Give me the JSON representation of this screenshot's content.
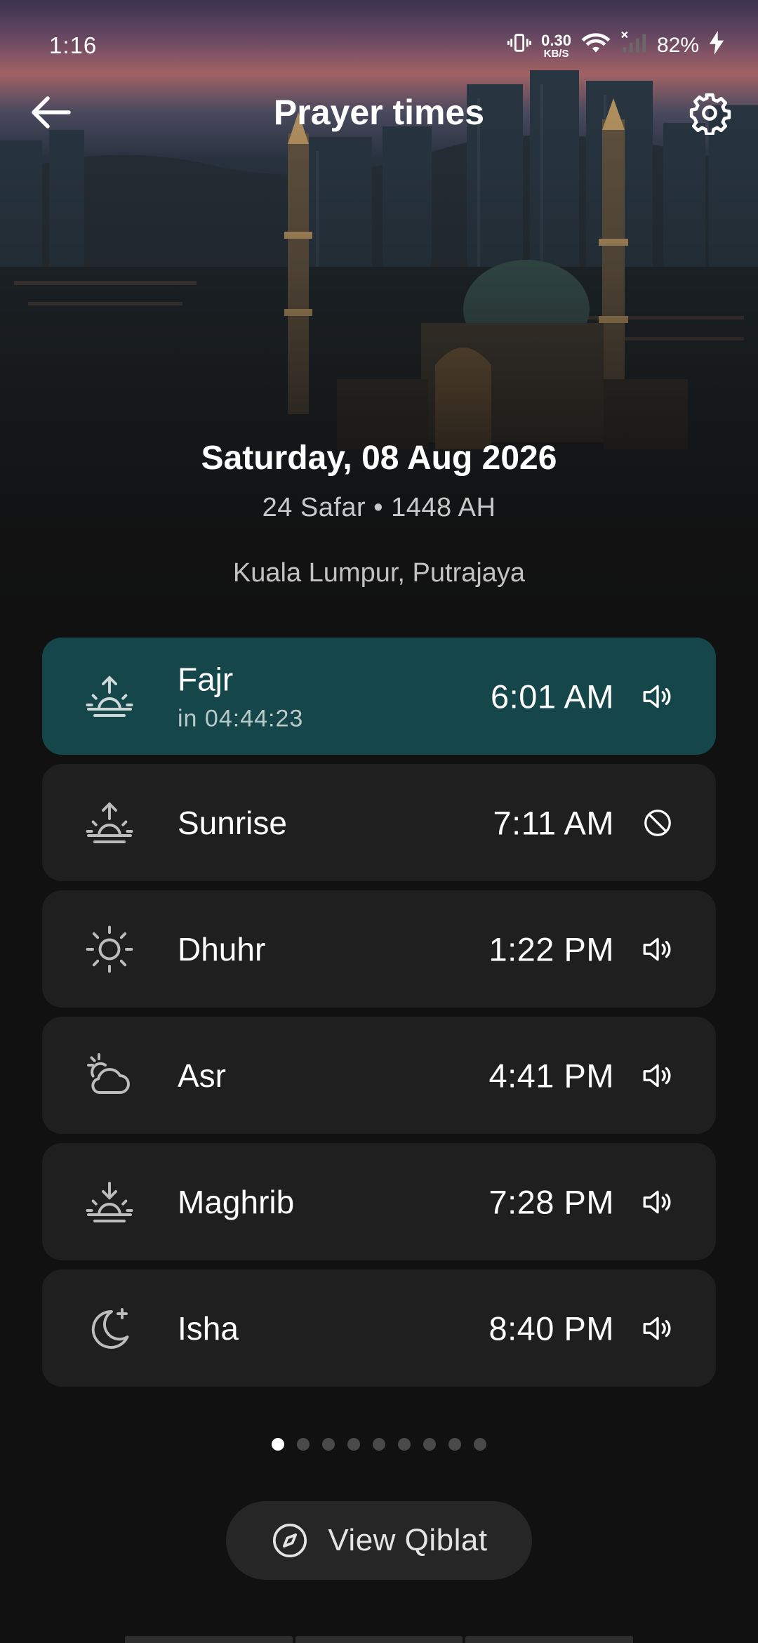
{
  "status_bar": {
    "time": "1:16",
    "net_speed_value": "0.30",
    "net_speed_unit": "KB/S",
    "battery": "82%"
  },
  "app_bar": {
    "title": "Prayer times",
    "back_icon": "arrow-left-icon",
    "settings_icon": "gear-icon"
  },
  "header": {
    "date": "Saturday, 08 Aug 2026",
    "hijri_date": "24 Safar • 1448 AH",
    "location": "Kuala Lumpur, Putrajaya"
  },
  "prayers": [
    {
      "name": "Fajr",
      "time": "6:01 AM",
      "countdown": "in 04:44:23",
      "icon": "sunrise-icon",
      "alert": "speaker-icon",
      "active": true
    },
    {
      "name": "Sunrise",
      "time": "7:11 AM",
      "icon": "sunrise-icon",
      "alert": "muted-icon",
      "active": false
    },
    {
      "name": "Dhuhr",
      "time": "1:22 PM",
      "icon": "sun-icon",
      "alert": "speaker-icon",
      "active": false
    },
    {
      "name": "Asr",
      "time": "4:41 PM",
      "icon": "cloud-sun-icon",
      "alert": "speaker-icon",
      "active": false
    },
    {
      "name": "Maghrib",
      "time": "7:28 PM",
      "icon": "sunset-icon",
      "alert": "speaker-icon",
      "active": false
    },
    {
      "name": "Isha",
      "time": "8:40 PM",
      "icon": "moon-star-icon",
      "alert": "speaker-icon",
      "active": false
    }
  ],
  "pagination": {
    "total": 9,
    "current": 1
  },
  "qiblat_button": {
    "label": "View Qiblat",
    "icon": "compass-icon"
  },
  "colors": {
    "background": "#111111",
    "card": "#1f1f1f",
    "active_card": "#14464a",
    "text_secondary": "#c2c2c2"
  }
}
